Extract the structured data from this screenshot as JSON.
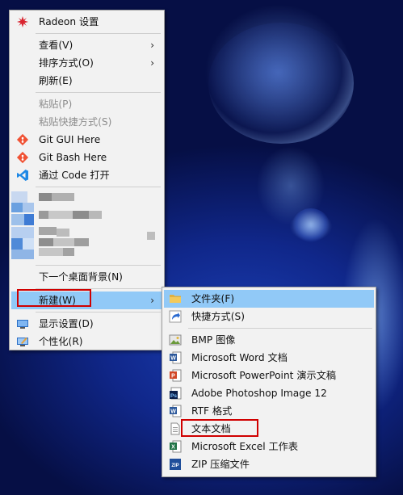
{
  "desktop_menu": {
    "radeon": "Radeon 设置",
    "view": "查看(V)",
    "sort": "排序方式(O)",
    "refresh": "刷新(E)",
    "paste": "粘贴(P)",
    "paste_shortcut": "粘贴快捷方式(S)",
    "git_gui": "Git GUI Here",
    "git_bash": "Git Bash Here",
    "open_code": "通过 Code 打开",
    "next_bg": "下一个桌面背景(N)",
    "new": "新建(W)",
    "display": "显示设置(D)",
    "personalize": "个性化(R)"
  },
  "new_submenu": {
    "folder": "文件夹(F)",
    "shortcut": "快捷方式(S)",
    "bmp": "BMP 图像",
    "word": "Microsoft Word 文档",
    "ppt": "Microsoft PowerPoint 演示文稿",
    "psd": "Adobe Photoshop Image 12",
    "rtf": "RTF 格式",
    "txt": "文本文档",
    "excel": "Microsoft Excel 工作表",
    "zip": "ZIP 压缩文件"
  },
  "colors": {
    "highlight": "#91c9f7",
    "annotation_red": "#d00000"
  }
}
